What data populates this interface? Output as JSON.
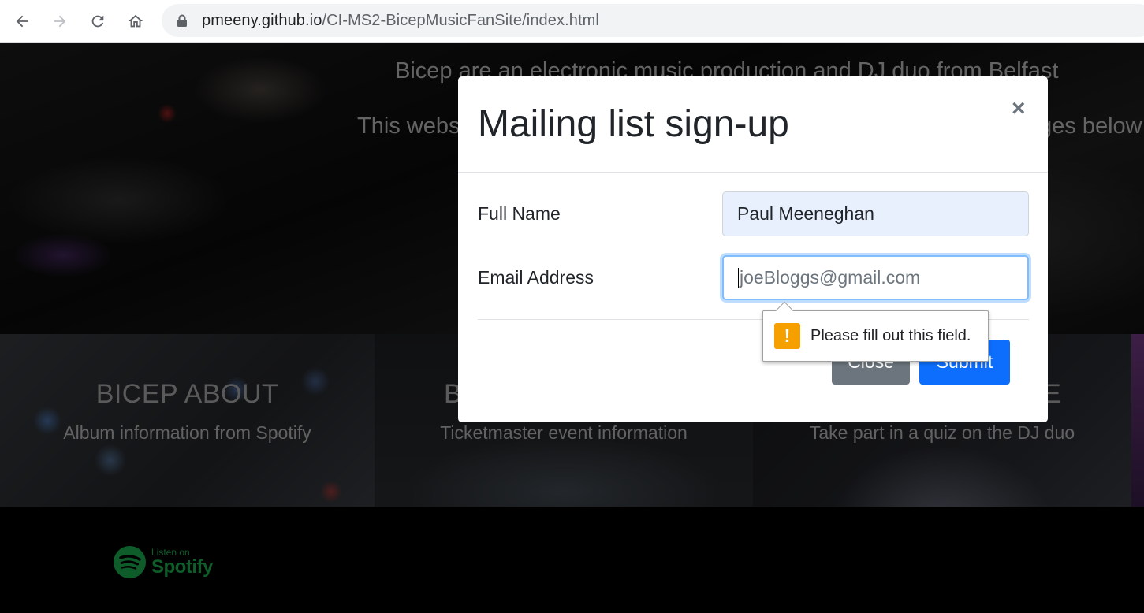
{
  "browser": {
    "url_host": "pmeeny.github.io",
    "url_path": "/CI-MS2-BicepMusicFanSite/index.html",
    "icons": [
      "back-arrow-icon",
      "forward-arrow-icon",
      "reload-icon",
      "home-icon",
      "lock-icon"
    ]
  },
  "hero": {
    "line1": "Bicep are an electronic music production and DJ duo from Belfast",
    "line2_left": "This webs",
    "line2_right": "ges below"
  },
  "cards": [
    {
      "title": "BICEP ABOUT",
      "subtitle": "Album information from Spotify"
    },
    {
      "title": "B",
      "subtitle": "Ticketmaster event information"
    },
    {
      "title": "E",
      "subtitle": "Take part in a quiz on the DJ duo"
    }
  ],
  "footer": {
    "spotify_small": "Listen on",
    "spotify_big": "Spotify",
    "brand_color": "#1db954"
  },
  "modal": {
    "title": "Mailing list sign-up",
    "close_symbol": "×",
    "fields": {
      "name_label": "Full Name",
      "name_value": "Paul Meeneghan",
      "email_label": "Email Address",
      "email_placeholder": "joeBloggs@gmail.com"
    },
    "buttons": {
      "close": "Close",
      "submit": "Submit"
    },
    "validation_message": "Please fill out this field.",
    "accent_color": "#0d6efd",
    "warning_color": "#f6a000"
  }
}
